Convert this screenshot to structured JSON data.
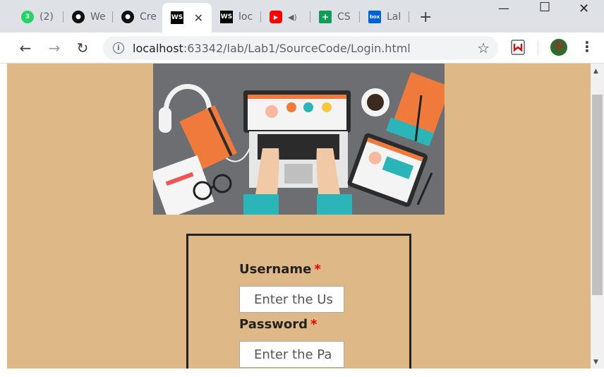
{
  "tabs": [
    {
      "title": "(2)",
      "icon": "whatsapp-icon",
      "color": "#25d366",
      "badge": "3"
    },
    {
      "title": "We",
      "icon": "github-icon",
      "color": "#111111"
    },
    {
      "title": "Cre",
      "icon": "github-icon",
      "color": "#111111"
    },
    {
      "title": "",
      "icon": "webstorm-icon",
      "color": "#000000",
      "active": true,
      "badge": "WS"
    },
    {
      "title": "loc",
      "icon": "webstorm-icon",
      "color": "#000000",
      "badge": "WS"
    },
    {
      "title": "",
      "icon": "youtube-icon",
      "color": "#ff0000"
    },
    {
      "title": "CS",
      "icon": "sheets-icon",
      "color": "#0f9d58"
    },
    {
      "title": "Lal",
      "icon": "box-icon",
      "color": "#0061d5",
      "badge": "box"
    }
  ],
  "address": {
    "host": "localhost",
    "rest": ":63342/lab/Lab1/SourceCode/Login.html"
  },
  "form": {
    "username_label": "Username",
    "username_placeholder": "Enter the Us",
    "password_label": "Password",
    "password_placeholder": "Enter the Pa",
    "required_mark": "*"
  },
  "colors": {
    "page_background": "#deb887",
    "required": "#ee0000"
  }
}
